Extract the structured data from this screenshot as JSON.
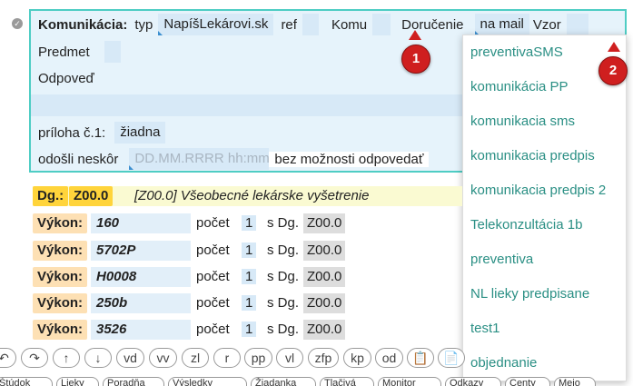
{
  "panel": {
    "komunikacia_label": "Komunikácia:",
    "typ_label": "typ",
    "typ_value": "NapíšLekárovi.sk",
    "ref_label": "ref",
    "komu_label": "Komu",
    "dorucenie_label": "Doručenie",
    "dorucenie_value": "na mail",
    "vzor_label": "Vzor",
    "predmet_label": "Predmet",
    "odpoved_label": "Odpoveď",
    "priloha_label": "príloha č.1:",
    "priloha_value": "žiadna",
    "odosli_label": "odošli neskôr",
    "date_placeholder": "DD.MM.RRRR hh:mm",
    "bez_label": "bez možnosti odpovedať"
  },
  "dropdown": {
    "items": [
      "preventivaSMS",
      "komunikácia PP",
      "komunikacia sms",
      "komunikacia predpis",
      "komunikacia predpis 2",
      "Telekonzultácia 1b",
      "preventiva",
      "NL lieky predpisane",
      "test1",
      "objednanie"
    ]
  },
  "badges": {
    "one": "1",
    "two": "2"
  },
  "diagnosis": {
    "label": "Dg.:",
    "code": "Z00.0",
    "text": "[Z00.0] Všeobecné lekárske vyšetrenie"
  },
  "vykony": {
    "label": "Výkon:",
    "pocet_label": "počet",
    "sdg_label": "s Dg.",
    "rows": [
      {
        "code": "160",
        "count": "1",
        "dg": "Z00.0"
      },
      {
        "code": "5702P",
        "count": "1",
        "dg": "Z00.0"
      },
      {
        "code": "H0008",
        "count": "1",
        "dg": "Z00.0"
      },
      {
        "code": "250b",
        "count": "1",
        "dg": "Z00.0"
      },
      {
        "code": "3526",
        "count": "1",
        "dg": "Z00.0"
      }
    ]
  },
  "toolbar": {
    "buttons": [
      "↶",
      "↷",
      "↑",
      "↓",
      "vd",
      "vv",
      "zl",
      "r",
      "pp",
      "vl",
      "zfp",
      "kp",
      "od",
      "📋",
      "📄",
      "🗐"
    ]
  },
  "bottom_tabs": [
    "Štúdok",
    "Lieky",
    "Poradňa",
    "Výsledky",
    "Žiadanka",
    "Tlačivá",
    "Monitor",
    "Odkazy",
    "Centy",
    "Meio"
  ],
  "colors": {
    "accent": "#4ecdc4",
    "link": "#2a8f84",
    "badge": "#cf1f1f",
    "dg": "#ffd43b"
  }
}
